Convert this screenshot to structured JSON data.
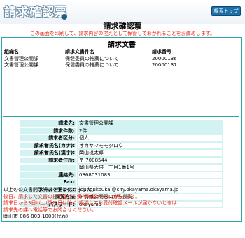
{
  "header": {
    "logo_text": "請求確認票",
    "top_button": "検索トップへ"
  },
  "page": {
    "title": "請求確認票",
    "note": "この画面を印刷して、請求内容の控えとして保管しておかれることをお薦めします。"
  },
  "doc": {
    "title": "請求文書",
    "columns": [
      "組織名",
      "請求文書件名",
      "請求番号"
    ],
    "rows": [
      [
        "文書管理公開課",
        "保健委員の推薦について",
        "20000136"
      ],
      [
        "文書管理公開課",
        "保健委員の推薦について",
        "20000137"
      ]
    ]
  },
  "details": [
    {
      "label": "請求先:",
      "value": "文書管理公開課"
    },
    {
      "label": "請求件数:",
      "value": "2件"
    },
    {
      "label": "請求者区分:",
      "value": "個人"
    },
    {
      "label": "請求者氏名(カナ):",
      "value": "オカヤマモモタロウ"
    },
    {
      "label": "請求者氏名(漢字):",
      "value": "岡山桃太郎"
    },
    {
      "label": "請求者住所:",
      "value": "〒 7008544"
    },
    {
      "label": "",
      "value": "岡山県大供一丁目1番1号"
    },
    {
      "label": "連絡先:",
      "value": "0868031083"
    },
    {
      "label": "Fax:",
      "value": ""
    },
    {
      "label": "メールアドレス:",
      "value": "jouhoukoukai@city.okayama.okayama.jp"
    },
    {
      "label": "閲覧方法",
      "value": "e-情報公開窓口から閲覧"
    },
    {
      "label": "パスワード:",
      "value": "okayama"
    }
  ],
  "footer": {
    "line1": "以上の公文書開示請求を受け付けました。",
    "line2": "後日、請求した文書の担当課から受付確認メールが届きます。",
    "line3": "請求日から3日以上(閉庁日は除く)経過しても受付確認メールが届かないときは、",
    "line4": "請求先の課へ電話等でお問合せください。",
    "line5": "岡山市 086-803-1000(代表)"
  },
  "colors": {
    "accent": "#2aa7a6",
    "label_bg": "#d3f2f2",
    "warning": "#e8210f",
    "button": "#1e6fa8"
  }
}
